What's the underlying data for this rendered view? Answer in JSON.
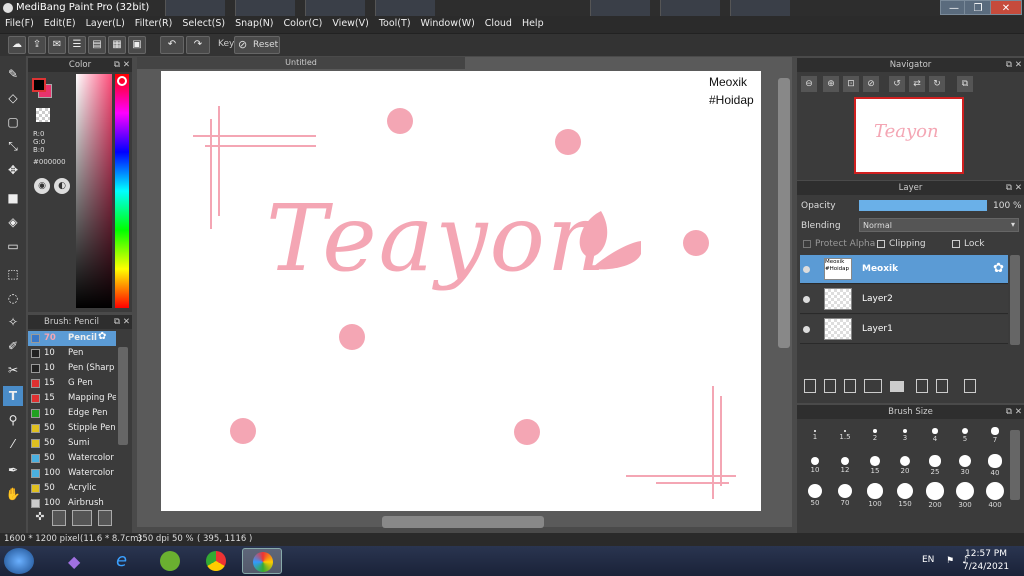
{
  "app": {
    "title": "MediBang Paint Pro (32bit)",
    "window_controls": [
      "—",
      "❐",
      "✕"
    ]
  },
  "menu": [
    "File(F)",
    "Edit(E)",
    "Layer(L)",
    "Filter(R)",
    "Select(S)",
    "Snap(N)",
    "Color(C)",
    "View(V)",
    "Tool(T)",
    "Window(W)",
    "Cloud",
    "Help"
  ],
  "toolbar": {
    "key_label": "Key",
    "reset_label": "Reset"
  },
  "color_panel": {
    "title": "Color",
    "r_label": "R:0",
    "g_label": "G:0",
    "b_label": "B:0",
    "hex": "#000000",
    "primary": "#000000",
    "secondary": "#e8336d"
  },
  "brush_panel": {
    "title": "Brush: Pencil",
    "brushes": [
      {
        "size": "70",
        "name": "Pencil",
        "color": "#3a78c8"
      },
      {
        "size": "10",
        "name": "Pen",
        "color": "#222222"
      },
      {
        "size": "10",
        "name": "Pen (Sharp",
        "color": "#222222"
      },
      {
        "size": "15",
        "name": "G Pen",
        "color": "#e03030"
      },
      {
        "size": "15",
        "name": "Mapping Pe",
        "color": "#e03030"
      },
      {
        "size": "10",
        "name": "Edge Pen",
        "color": "#20a020"
      },
      {
        "size": "50",
        "name": "Stipple Pen",
        "color": "#e0c020"
      },
      {
        "size": "50",
        "name": "Sumi",
        "color": "#e0c020"
      },
      {
        "size": "50",
        "name": "Watercolor",
        "color": "#4ab0e0"
      },
      {
        "size": "100",
        "name": "Watercolor",
        "color": "#4ab0e0"
      },
      {
        "size": "50",
        "name": "Acrylic",
        "color": "#e0c020"
      },
      {
        "size": "100",
        "name": "Airbrush",
        "color": "#cccccc"
      }
    ]
  },
  "canvas": {
    "tab_title": "Untitled",
    "watermark_line1": "Meoxik",
    "watermark_line2": "#Hoidap",
    "lettering": "Teayon",
    "ink_color": "#f4a6b4"
  },
  "navigator": {
    "title": "Navigator"
  },
  "layer_panel": {
    "title": "Layer",
    "opacity_label": "Opacity",
    "opacity_value": "100 %",
    "opacity": 1.0,
    "blending_label": "Blending",
    "blending_value": "Normal",
    "protect_alpha_label": "Protect Alpha",
    "clipping_label": "Clipping",
    "lock_label": "Lock",
    "layers": [
      {
        "name": "Meoxik",
        "thumb": "Meoxik #Hoidap"
      },
      {
        "name": "Layer2",
        "thumb": ""
      },
      {
        "name": "Layer1",
        "thumb": ""
      }
    ]
  },
  "brush_size_panel": {
    "title": "Brush Size",
    "sizes": [
      "1",
      "1.5",
      "2",
      "3",
      "4",
      "5",
      "7",
      "10",
      "12",
      "15",
      "20",
      "25",
      "30",
      "40",
      "50",
      "70",
      "100",
      "150",
      "200",
      "300",
      "400"
    ]
  },
  "status": {
    "dimensions": "1600 * 1200 pixel",
    "physical": "(11.6 * 8.7cm)",
    "dpi": "350 dpi",
    "zoom": "50 %",
    "coords": "( 395, 1116 )"
  },
  "taskbar": {
    "lang": "EN",
    "time": "12:57 PM",
    "date": "7/24/2021"
  }
}
